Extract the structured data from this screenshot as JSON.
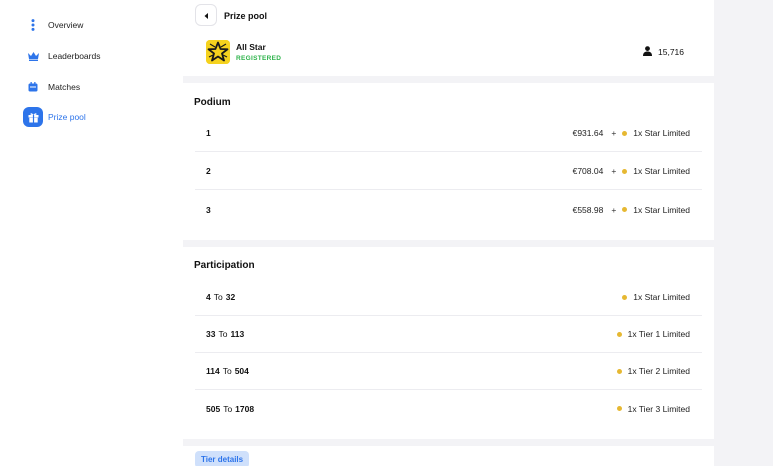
{
  "sidebar": {
    "items": [
      {
        "label": "Overview",
        "icon": "vertical-dots-icon"
      },
      {
        "label": "Leaderboards",
        "icon": "crown-icon"
      },
      {
        "label": "Matches",
        "icon": "calendar-icon"
      },
      {
        "label": "Prize pool",
        "icon": "gift-icon",
        "active": true
      }
    ]
  },
  "header": {
    "title": "Prize pool",
    "league": {
      "name": "All Star",
      "status": "REGISTERED"
    },
    "participants": "15,716"
  },
  "podium": {
    "title": "Podium",
    "rows": [
      {
        "rank": "1",
        "amount": "€931.64",
        "plus": "+",
        "reward": "1x Star Limited"
      },
      {
        "rank": "2",
        "amount": "€708.04",
        "plus": "+",
        "reward": "1x Star Limited"
      },
      {
        "rank": "3",
        "amount": "€558.98",
        "plus": "+",
        "reward": "1x Star Limited"
      }
    ]
  },
  "participation": {
    "title": "Participation",
    "to_word": "To",
    "rows": [
      {
        "from": "4",
        "to": "32",
        "reward": "1x Star Limited"
      },
      {
        "from": "33",
        "to": "113",
        "reward": "1x Tier 1 Limited"
      },
      {
        "from": "114",
        "to": "504",
        "reward": "1x Tier 2 Limited"
      },
      {
        "from": "505",
        "to": "1708",
        "reward": "1x Tier 3 Limited"
      }
    ]
  },
  "tier_details": {
    "label": "Tier details"
  },
  "colors": {
    "accent": "#2d74ea",
    "registered": "#2db34a",
    "reward_dot": "#e6b832",
    "logo_bg": "#f5d21e"
  }
}
